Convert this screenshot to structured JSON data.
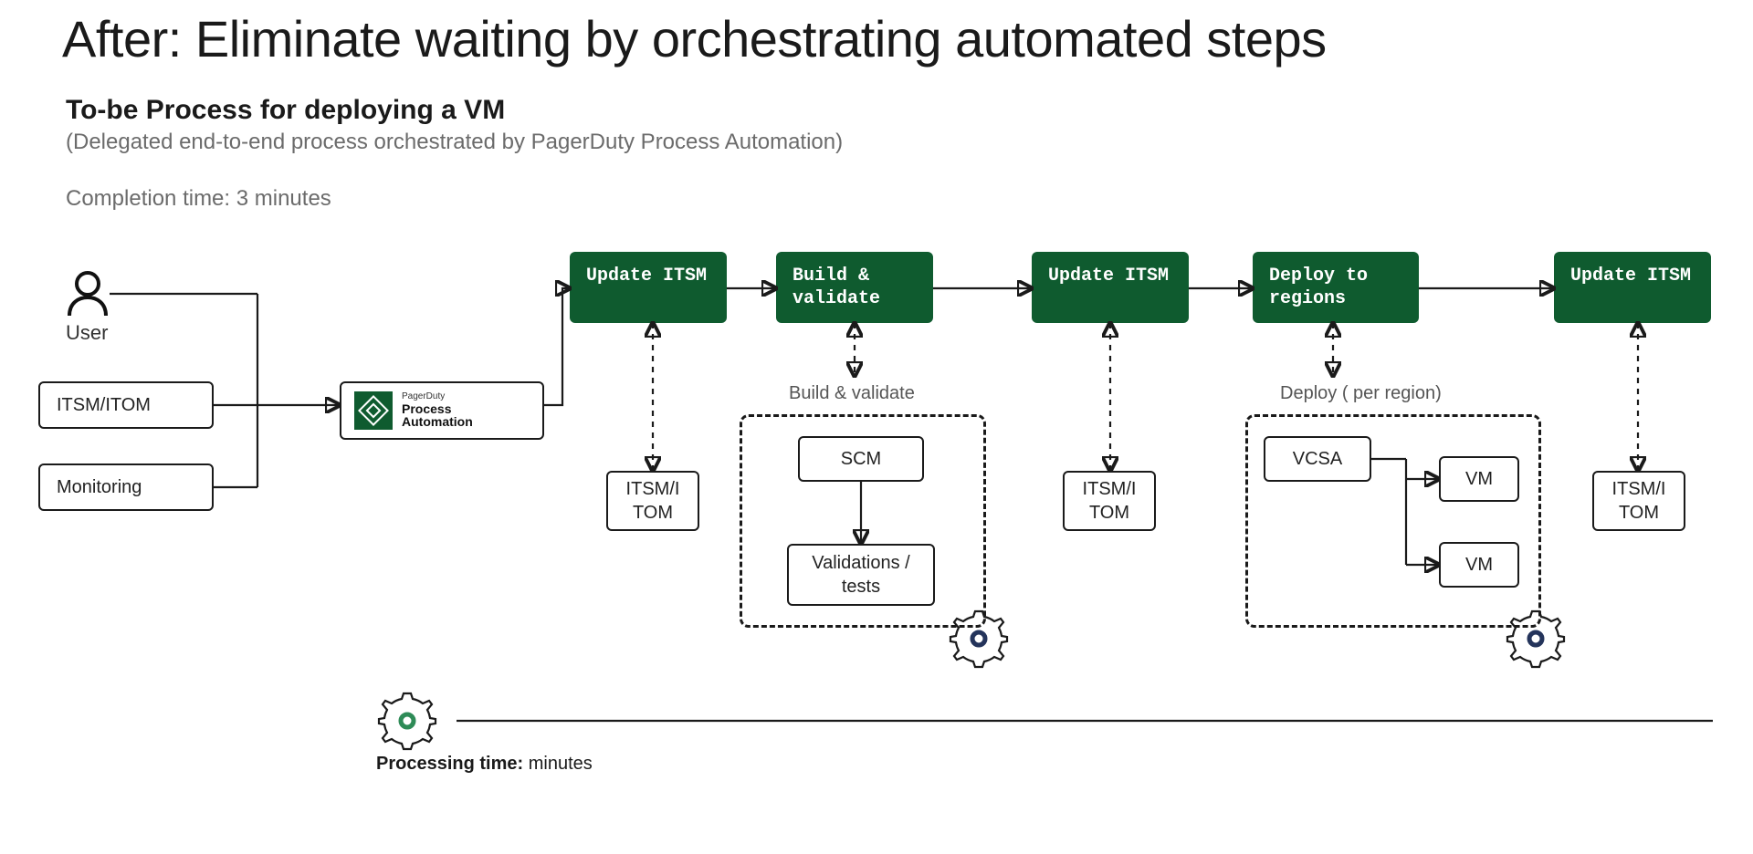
{
  "colors": {
    "step_green": "#0f5b2f",
    "gear_green": "#2e8b57",
    "gear_navy": "#24345b"
  },
  "header": {
    "title": "After: Eliminate waiting by orchestrating automated steps",
    "subtitle_bold": "To-be Process for deploying a VM",
    "subtitle_paren": "(Delegated end-to-end process orchestrated by PagerDuty Process Automation)",
    "completion": "Completion time: 3 minutes"
  },
  "inputs": {
    "user_label": "User",
    "itsm_itom": "ITSM/ITOM",
    "monitoring": "Monitoring"
  },
  "process_automation": {
    "brand_small": "PagerDuty",
    "line1": "Process",
    "line2": "Automation"
  },
  "steps": {
    "s1": "Update ITSM",
    "s2": "Build & validate",
    "s3": "Update ITSM",
    "s4": "Deploy to regions",
    "s5": "Update ITSM"
  },
  "detail": {
    "itsm_itom_block": "ITSM/I TOM",
    "build_validate_title": "Build & validate",
    "scm": "SCM",
    "validations": "Validations / tests",
    "deploy_title": "Deploy ( per region)",
    "vcsa": "VCSA",
    "vm": "VM"
  },
  "footer": {
    "processing_label": "Processing time:",
    "processing_value": " minutes"
  }
}
